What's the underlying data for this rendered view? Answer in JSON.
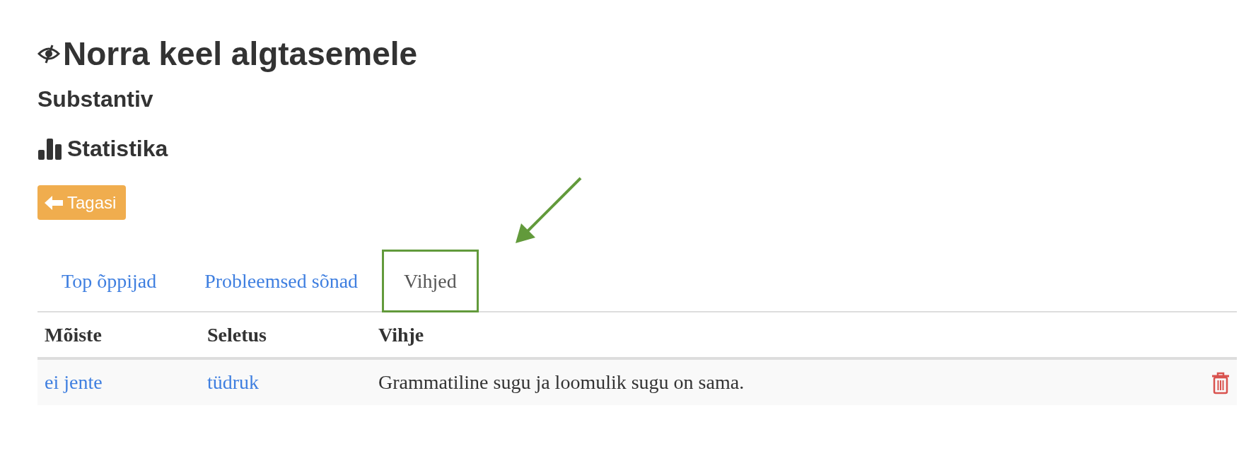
{
  "title": "Norra keel algtasemele",
  "subtitle": "Substantiv",
  "section": "Statistika",
  "back_button": "Tagasi",
  "tabs": [
    {
      "label": "Top õppijad",
      "selected": false
    },
    {
      "label": "Probleemsed sõnad",
      "selected": false
    },
    {
      "label": "Vihjed",
      "selected": true
    }
  ],
  "table": {
    "columns": [
      "Mõiste",
      "Seletus",
      "Vihje"
    ],
    "rows": [
      {
        "term": "ei jente",
        "explanation": "tüdruk",
        "hint": "Grammatiline sugu ja loomulik sugu on sama."
      }
    ]
  }
}
